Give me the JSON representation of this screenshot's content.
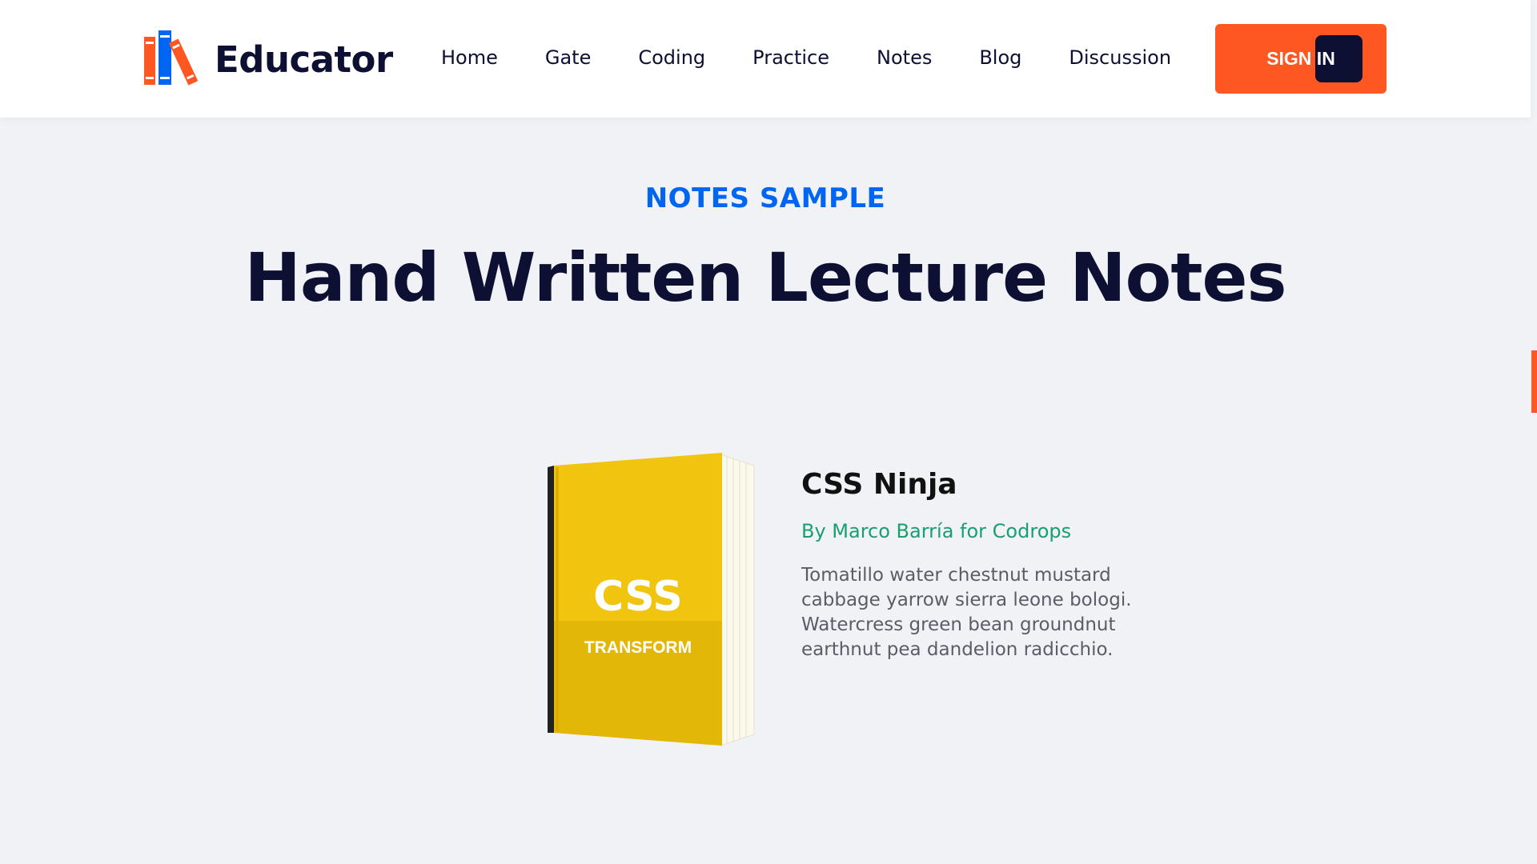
{
  "header": {
    "brand": "Educator",
    "nav": [
      "Home",
      "Gate",
      "Coding",
      "Practice",
      "Notes",
      "Blog",
      "Discussion"
    ],
    "signin_label": "SIGN IN"
  },
  "hero": {
    "eyebrow": "NOTES SAMPLE",
    "title": "Hand Written Lecture Notes"
  },
  "book": {
    "cover_title": "CSS",
    "cover_subtitle": "TRANSFORM",
    "title": "CSS Ninja",
    "author": "By Marco Barría for Codrops",
    "description": "Tomatillo water chestnut mustard cabbage yarrow sierra leone bologi. Watercress green bean groundnut earthnut pea dandelion radicchio."
  },
  "colors": {
    "accent": "#ff5722",
    "navy": "#0d0f33",
    "eyebrow": "#0066f2",
    "author": "#17a06e",
    "book_cover": "#f0c40f"
  },
  "icons": [
    "books-logo-icon"
  ]
}
